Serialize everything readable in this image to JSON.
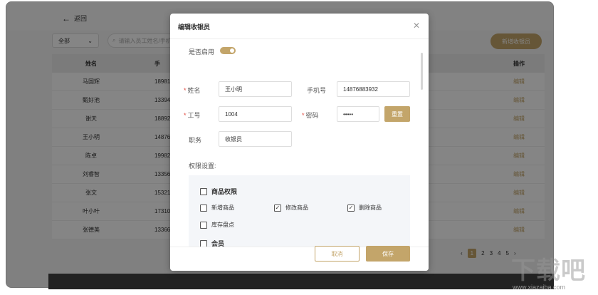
{
  "page": {
    "back_label": "返回",
    "filter_label": "全部",
    "search_placeholder": "请输入员工姓名/手机号",
    "add_button": "新增收银员"
  },
  "table": {
    "headers": {
      "name": "姓名",
      "phone": "手",
      "op": "操作"
    },
    "rows": [
      {
        "name": "马国辉",
        "phone": "18981",
        "op": "编辑"
      },
      {
        "name": "甄好池",
        "phone": "13394",
        "op": "编辑"
      },
      {
        "name": "谢天",
        "phone": "18892",
        "op": "编辑"
      },
      {
        "name": "王小明",
        "phone": "14876",
        "op": "编辑"
      },
      {
        "name": "陈卓",
        "phone": "19982",
        "op": "编辑"
      },
      {
        "name": "刘睿智",
        "phone": "13356",
        "op": "编辑"
      },
      {
        "name": "张文",
        "phone": "15321",
        "op": "编辑"
      },
      {
        "name": "叶小叶",
        "phone": "17310",
        "op": "编辑"
      },
      {
        "name": "张德美",
        "phone": "13366",
        "op": "编辑"
      }
    ]
  },
  "pagination": {
    "pages": [
      "1",
      "2",
      "3",
      "4",
      "5"
    ],
    "current": "1"
  },
  "modal": {
    "title": "编辑收银员",
    "enabled_label": "是否启用",
    "enabled": true,
    "name_label": "姓名",
    "name_value": "王小明",
    "phone_label": "手机号",
    "phone_value": "14876883932",
    "id_label": "工号",
    "id_value": "1004",
    "password_label": "密码",
    "password_value": "•••••",
    "reset_button": "重置",
    "role_label": "职务",
    "role_value": "收银员",
    "perm_label": "权限设置:",
    "permissions": {
      "group1": {
        "label": "商品权限",
        "checked": false
      },
      "items": [
        {
          "label": "新增商品",
          "checked": false
        },
        {
          "label": "修改商品",
          "checked": true
        },
        {
          "label": "删除商品",
          "checked": true
        },
        {
          "label": "库存盘点",
          "checked": false
        }
      ],
      "group2": {
        "label": "会员",
        "checked": false
      }
    },
    "cancel_button": "取消",
    "save_button": "保存"
  },
  "watermark": {
    "logo": "下载吧",
    "url": "www.xiazaiba.com"
  },
  "colors": {
    "accent": "#c3a56a",
    "required": "#e0483e"
  }
}
